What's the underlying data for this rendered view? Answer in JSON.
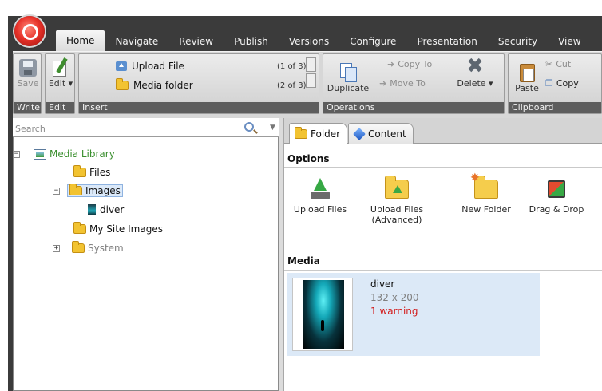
{
  "ribbon": {
    "tabs": [
      {
        "label": "Home",
        "active": true
      },
      {
        "label": "Navigate"
      },
      {
        "label": "Review"
      },
      {
        "label": "Publish"
      },
      {
        "label": "Versions"
      },
      {
        "label": "Configure"
      },
      {
        "label": "Presentation"
      },
      {
        "label": "Security"
      },
      {
        "label": "View"
      }
    ],
    "groups": {
      "write": {
        "label": "Write",
        "save": "Save"
      },
      "edit": {
        "label": "Edit",
        "edit": "Edit ▾"
      },
      "insert": {
        "label": "Insert",
        "items": [
          {
            "label": "Upload File",
            "count": "(1 of 3)",
            "icon": "upload-file-icon"
          },
          {
            "label": "Media folder",
            "count": "(2 of 3)",
            "icon": "folder-icon"
          }
        ]
      },
      "operations": {
        "label": "Operations",
        "duplicate": "Duplicate",
        "copy_to": "Copy To",
        "move_to": "Move To",
        "delete": "Delete ▾"
      },
      "clipboard": {
        "label": "Clipboard",
        "paste": "Paste",
        "cut": "Cut",
        "copy": "Copy"
      }
    }
  },
  "search": {
    "placeholder": "Search",
    "value": ""
  },
  "tree": [
    {
      "label": "Media Library",
      "toggle": "−",
      "icon": "media-library-icon",
      "color": "#3a8f2e"
    },
    {
      "label": "Files",
      "icon": "folder-icon"
    },
    {
      "label": "Images",
      "toggle": "−",
      "icon": "folder-icon",
      "selected": true
    },
    {
      "label": "diver",
      "icon": "image-icon"
    },
    {
      "label": "My Site Images",
      "icon": "folder-icon"
    },
    {
      "label": "System",
      "toggle": "+",
      "icon": "folder-icon",
      "color": "#808080"
    }
  ],
  "content": {
    "tabs": [
      {
        "label": "Folder",
        "active": true,
        "icon": "folder-icon"
      },
      {
        "label": "Content",
        "icon": "content-cube-icon"
      }
    ],
    "options_heading": "Options",
    "options": [
      {
        "label": "Upload Files",
        "icon": "upload-files-icon"
      },
      {
        "label": "Upload Files",
        "label2": "(Advanced)",
        "icon": "upload-files-advanced-icon"
      },
      {
        "label": "New Folder",
        "icon": "new-folder-icon"
      },
      {
        "label": "Drag & Drop",
        "icon": "drag-drop-icon"
      }
    ],
    "media_heading": "Media",
    "media": [
      {
        "name": "diver",
        "dimensions": "132 x 200",
        "warning": "1 warning"
      }
    ]
  },
  "colors": {
    "ribbon_dark": "#3b3b3b",
    "selection": "#dce9f7",
    "warning": "#d21c1c",
    "group_label": "#5d5d5d"
  }
}
